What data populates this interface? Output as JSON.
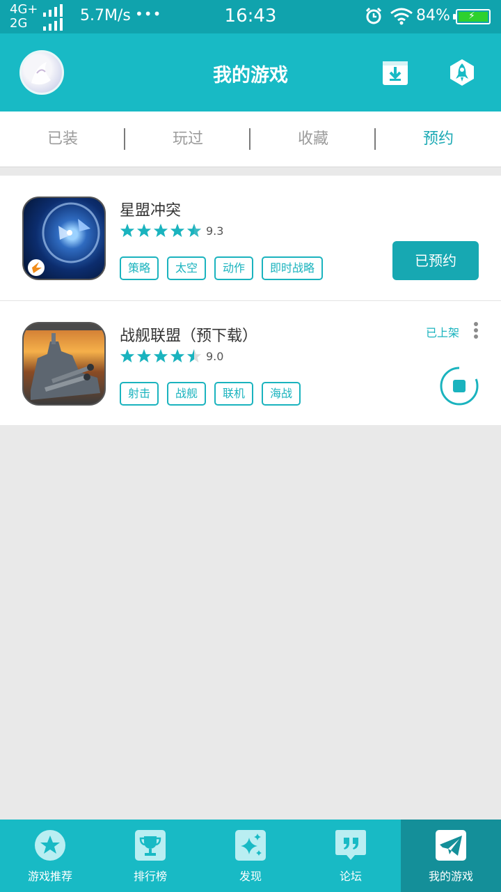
{
  "status_bar": {
    "network_top": "4G+",
    "network_bottom": "2G",
    "speed": "5.7M/s",
    "dots": "•••",
    "time": "16:43",
    "battery": "84%"
  },
  "header": {
    "title": "我的游戏"
  },
  "tabs": [
    {
      "label": "已装",
      "active": false
    },
    {
      "label": "玩过",
      "active": false
    },
    {
      "label": "收藏",
      "active": false
    },
    {
      "label": "预约",
      "active": true
    }
  ],
  "games": [
    {
      "name": "星盟冲突",
      "rating": "9.3",
      "stars": 4.5,
      "tags": [
        "策略",
        "太空",
        "动作",
        "即时战略"
      ],
      "action_label": "已预约"
    },
    {
      "name": "战舰联盟（预下载）",
      "rating": "9.0",
      "stars": 4.5,
      "tags": [
        "射击",
        "战舰",
        "联机",
        "海战"
      ],
      "status_label": "已上架"
    }
  ],
  "bottom_nav": [
    {
      "label": "游戏推荐",
      "icon": "star-icon",
      "active": false
    },
    {
      "label": "排行榜",
      "icon": "trophy-icon",
      "active": false
    },
    {
      "label": "发现",
      "icon": "sparkle-icon",
      "active": false
    },
    {
      "label": "论坛",
      "icon": "quote-icon",
      "active": false
    },
    {
      "label": "我的游戏",
      "icon": "paper-plane-icon",
      "active": true
    }
  ],
  "colors": {
    "accent": "#18bac5",
    "accent_dark": "#148f99",
    "status_bar": "#10a3ad"
  }
}
